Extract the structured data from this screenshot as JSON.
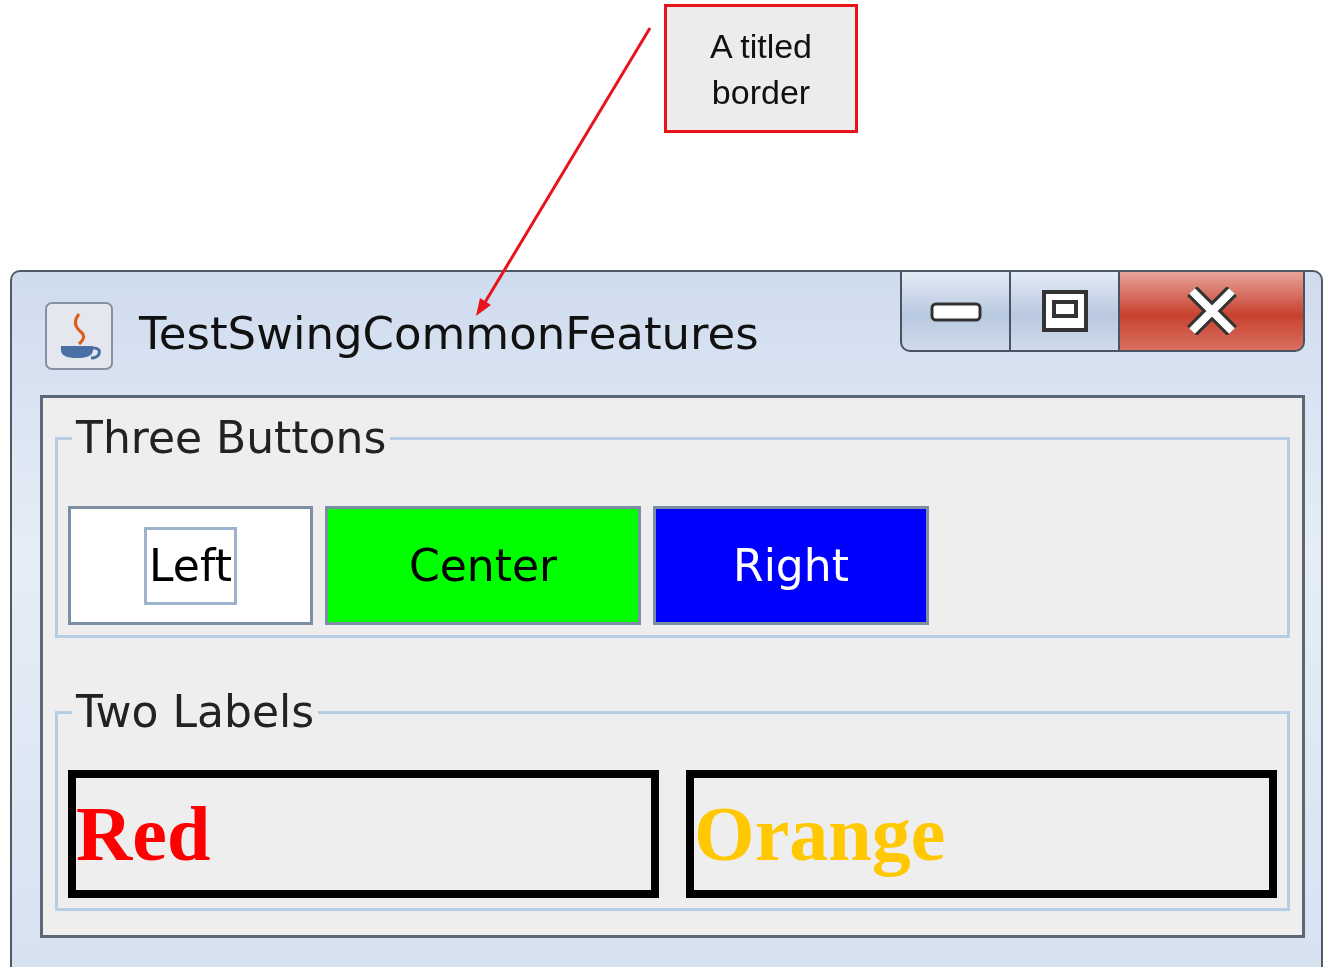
{
  "annotation": {
    "text": "A titled border"
  },
  "window": {
    "title": "TestSwingCommonFeatures"
  },
  "button_group": {
    "title": "Three Buttons",
    "buttons": [
      {
        "label": "Left",
        "color": "#ffffff",
        "focused": true
      },
      {
        "label": "Center",
        "color": "#00ff00",
        "focused": false
      },
      {
        "label": "Right",
        "color": "#0000ff",
        "focused": false
      }
    ]
  },
  "label_group": {
    "title": "Two Labels",
    "labels": [
      {
        "text": "Red",
        "color": "#ff0000"
      },
      {
        "text": "Orange",
        "color": "#ffc800"
      }
    ]
  }
}
